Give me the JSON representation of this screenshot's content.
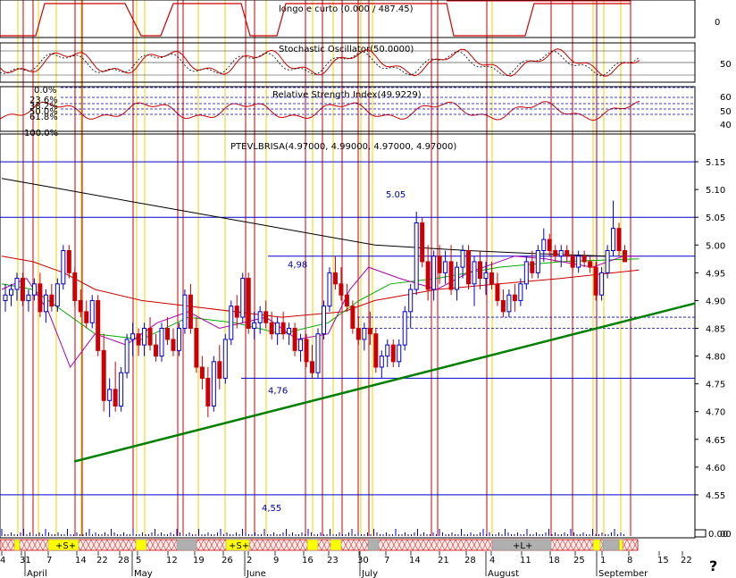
{
  "chart_data": {
    "type": "candlestick",
    "instrument_title": "PTEVLBRISA(4.97000, 4.99000, 4.97000, 4.97000)",
    "indicator_titles": {
      "top": "longo e curto (0.000 / 487.45)",
      "stochastic": "Stochastic Oscillator(50.0000)",
      "rsi": "Relative Strength Index(49.9229)"
    },
    "price_axis": {
      "ylim": [
        4.5,
        5.2
      ],
      "ticks": [
        "5.15",
        "5.10",
        "5.05",
        "5.00",
        "4.95",
        "4.90",
        "4.85",
        "4.80",
        "4.75",
        "4.70",
        "4.65",
        "4.60",
        "4.55"
      ]
    },
    "top_axis_ticks": [
      "0"
    ],
    "stochastic_axis_ticks": [
      "50"
    ],
    "rsi_axis_ticks": [
      "60",
      "50",
      "40"
    ],
    "fibonacci_levels": [
      "0.0%",
      "23.6%",
      "38.2%",
      "50.0%",
      "61.8%",
      "100.0%"
    ],
    "date_ticks": [
      "4",
      "31",
      "7",
      "14",
      "22",
      "28",
      "5",
      "12",
      "19",
      "26",
      "2",
      "9",
      "16",
      "23",
      "30",
      "7",
      "14",
      "21",
      "28",
      "4",
      "11",
      "18",
      "25",
      "1",
      "8",
      "15",
      "22"
    ],
    "month_labels": [
      "April",
      "May",
      "June",
      "July",
      "August",
      "September"
    ],
    "volume_axis_tick": "0.00",
    "horizontal_levels": [
      {
        "value": 5.15,
        "label": ""
      },
      {
        "value": 5.05,
        "label": "5.05"
      },
      {
        "value": 4.98,
        "label": "4,98"
      },
      {
        "value": 4.76,
        "label": "4,76"
      },
      {
        "value": 4.55,
        "label": "4,55"
      }
    ],
    "trendline": {
      "start": {
        "bar": 21,
        "price": 4.61
      },
      "end": {
        "bar": 200,
        "price": 4.935
      }
    },
    "candles": [
      {
        "o": 4.9,
        "h": 4.93,
        "l": 4.88,
        "c": 4.91
      },
      {
        "o": 4.91,
        "h": 4.93,
        "l": 4.89,
        "c": 4.92
      },
      {
        "o": 4.92,
        "h": 4.95,
        "l": 4.9,
        "c": 4.94
      },
      {
        "o": 4.94,
        "h": 4.95,
        "l": 4.89,
        "c": 4.9
      },
      {
        "o": 4.9,
        "h": 4.92,
        "l": 4.88,
        "c": 4.91
      },
      {
        "o": 4.91,
        "h": 4.94,
        "l": 4.9,
        "c": 4.93
      },
      {
        "o": 4.93,
        "h": 4.95,
        "l": 4.87,
        "c": 4.88
      },
      {
        "o": 4.88,
        "h": 4.92,
        "l": 4.86,
        "c": 4.91
      },
      {
        "o": 4.91,
        "h": 4.93,
        "l": 4.88,
        "c": 4.89
      },
      {
        "o": 4.89,
        "h": 4.94,
        "l": 4.88,
        "c": 4.93
      },
      {
        "o": 4.93,
        "h": 5.0,
        "l": 4.92,
        "c": 4.99
      },
      {
        "o": 4.99,
        "h": 5.0,
        "l": 4.94,
        "c": 4.95
      },
      {
        "o": 4.95,
        "h": 4.96,
        "l": 4.89,
        "c": 4.9
      },
      {
        "o": 4.9,
        "h": 4.92,
        "l": 4.87,
        "c": 4.88
      },
      {
        "o": 4.88,
        "h": 4.9,
        "l": 4.85,
        "c": 4.86
      },
      {
        "o": 4.86,
        "h": 4.91,
        "l": 4.85,
        "c": 4.9
      },
      {
        "o": 4.9,
        "h": 4.91,
        "l": 4.8,
        "c": 4.81
      },
      {
        "o": 4.81,
        "h": 4.84,
        "l": 4.7,
        "c": 4.72
      },
      {
        "o": 4.72,
        "h": 4.76,
        "l": 4.69,
        "c": 4.74
      },
      {
        "o": 4.74,
        "h": 4.79,
        "l": 4.7,
        "c": 4.71
      },
      {
        "o": 4.71,
        "h": 4.78,
        "l": 4.7,
        "c": 4.77
      },
      {
        "o": 4.77,
        "h": 4.84,
        "l": 4.76,
        "c": 4.83
      },
      {
        "o": 4.83,
        "h": 4.86,
        "l": 4.8,
        "c": 4.84
      },
      {
        "o": 4.84,
        "h": 4.85,
        "l": 4.8,
        "c": 4.82
      },
      {
        "o": 4.82,
        "h": 4.86,
        "l": 4.8,
        "c": 4.85
      },
      {
        "o": 4.85,
        "h": 4.87,
        "l": 4.81,
        "c": 4.82
      },
      {
        "o": 4.82,
        "h": 4.84,
        "l": 4.79,
        "c": 4.8
      },
      {
        "o": 4.8,
        "h": 4.86,
        "l": 4.79,
        "c": 4.85
      },
      {
        "o": 4.85,
        "h": 4.87,
        "l": 4.82,
        "c": 4.83
      },
      {
        "o": 4.83,
        "h": 4.85,
        "l": 4.8,
        "c": 4.81
      },
      {
        "o": 4.81,
        "h": 4.86,
        "l": 4.8,
        "c": 4.85
      },
      {
        "o": 4.85,
        "h": 4.92,
        "l": 4.84,
        "c": 4.91
      },
      {
        "o": 4.91,
        "h": 4.93,
        "l": 4.84,
        "c": 4.85
      },
      {
        "o": 4.85,
        "h": 4.87,
        "l": 4.77,
        "c": 4.78
      },
      {
        "o": 4.78,
        "h": 4.8,
        "l": 4.74,
        "c": 4.76
      },
      {
        "o": 4.76,
        "h": 4.78,
        "l": 4.69,
        "c": 4.71
      },
      {
        "o": 4.71,
        "h": 4.8,
        "l": 4.7,
        "c": 4.79
      },
      {
        "o": 4.79,
        "h": 4.82,
        "l": 4.74,
        "c": 4.76
      },
      {
        "o": 4.76,
        "h": 4.84,
        "l": 4.75,
        "c": 4.83
      },
      {
        "o": 4.83,
        "h": 4.9,
        "l": 4.82,
        "c": 4.89
      },
      {
        "o": 4.89,
        "h": 4.91,
        "l": 4.85,
        "c": 4.87
      },
      {
        "o": 4.87,
        "h": 4.95,
        "l": 4.86,
        "c": 4.94
      },
      {
        "o": 4.94,
        "h": 4.95,
        "l": 4.84,
        "c": 4.85
      },
      {
        "o": 4.85,
        "h": 4.88,
        "l": 4.83,
        "c": 4.86
      },
      {
        "o": 4.86,
        "h": 4.89,
        "l": 4.84,
        "c": 4.88
      },
      {
        "o": 4.88,
        "h": 4.9,
        "l": 4.85,
        "c": 4.86
      },
      {
        "o": 4.86,
        "h": 4.88,
        "l": 4.83,
        "c": 4.84
      },
      {
        "o": 4.84,
        "h": 4.87,
        "l": 4.82,
        "c": 4.86
      },
      {
        "o": 4.86,
        "h": 4.88,
        "l": 4.83,
        "c": 4.84
      },
      {
        "o": 4.84,
        "h": 4.86,
        "l": 4.82,
        "c": 4.85
      },
      {
        "o": 4.85,
        "h": 4.86,
        "l": 4.8,
        "c": 4.81
      },
      {
        "o": 4.81,
        "h": 4.84,
        "l": 4.79,
        "c": 4.83
      },
      {
        "o": 4.83,
        "h": 4.84,
        "l": 4.78,
        "c": 4.79
      },
      {
        "o": 4.79,
        "h": 4.82,
        "l": 4.76,
        "c": 4.77
      },
      {
        "o": 4.77,
        "h": 4.85,
        "l": 4.76,
        "c": 4.84
      },
      {
        "o": 4.84,
        "h": 4.9,
        "l": 4.83,
        "c": 4.89
      },
      {
        "o": 4.89,
        "h": 4.96,
        "l": 4.88,
        "c": 4.95
      },
      {
        "o": 4.95,
        "h": 4.98,
        "l": 4.92,
        "c": 4.93
      },
      {
        "o": 4.93,
        "h": 4.96,
        "l": 4.9,
        "c": 4.91
      },
      {
        "o": 4.91,
        "h": 4.93,
        "l": 4.88,
        "c": 4.89
      },
      {
        "o": 4.89,
        "h": 4.9,
        "l": 4.84,
        "c": 4.85
      },
      {
        "o": 4.85,
        "h": 4.87,
        "l": 4.82,
        "c": 4.83
      },
      {
        "o": 4.83,
        "h": 4.86,
        "l": 4.81,
        "c": 4.85
      },
      {
        "o": 4.85,
        "h": 4.88,
        "l": 4.82,
        "c": 4.84
      },
      {
        "o": 4.84,
        "h": 4.85,
        "l": 4.77,
        "c": 4.78
      },
      {
        "o": 4.78,
        "h": 4.81,
        "l": 4.76,
        "c": 4.8
      },
      {
        "o": 4.8,
        "h": 4.83,
        "l": 4.78,
        "c": 4.82
      },
      {
        "o": 4.82,
        "h": 4.83,
        "l": 4.78,
        "c": 4.79
      },
      {
        "o": 4.79,
        "h": 4.83,
        "l": 4.78,
        "c": 4.82
      },
      {
        "o": 4.82,
        "h": 4.89,
        "l": 4.81,
        "c": 4.88
      },
      {
        "o": 4.88,
        "h": 4.93,
        "l": 4.85,
        "c": 4.92
      },
      {
        "o": 4.92,
        "h": 5.06,
        "l": 4.91,
        "c": 5.04
      },
      {
        "o": 5.04,
        "h": 5.05,
        "l": 4.96,
        "c": 4.97
      },
      {
        "o": 4.97,
        "h": 5.0,
        "l": 4.9,
        "c": 4.92
      },
      {
        "o": 4.92,
        "h": 4.99,
        "l": 4.9,
        "c": 4.98
      },
      {
        "o": 4.98,
        "h": 5.0,
        "l": 4.93,
        "c": 4.95
      },
      {
        "o": 4.95,
        "h": 4.99,
        "l": 4.93,
        "c": 4.97
      },
      {
        "o": 4.97,
        "h": 5.0,
        "l": 4.91,
        "c": 4.92
      },
      {
        "o": 4.92,
        "h": 4.97,
        "l": 4.9,
        "c": 4.96
      },
      {
        "o": 4.96,
        "h": 5.0,
        "l": 4.94,
        "c": 4.99
      },
      {
        "o": 4.99,
        "h": 5.0,
        "l": 4.92,
        "c": 4.93
      },
      {
        "o": 4.93,
        "h": 4.98,
        "l": 4.89,
        "c": 4.97
      },
      {
        "o": 4.97,
        "h": 4.99,
        "l": 4.92,
        "c": 4.94
      },
      {
        "o": 4.94,
        "h": 4.97,
        "l": 4.91,
        "c": 4.95
      },
      {
        "o": 4.95,
        "h": 4.97,
        "l": 4.92,
        "c": 4.93
      },
      {
        "o": 4.93,
        "h": 4.95,
        "l": 4.89,
        "c": 4.9
      },
      {
        "o": 4.9,
        "h": 4.92,
        "l": 4.87,
        "c": 4.88
      },
      {
        "o": 4.88,
        "h": 4.92,
        "l": 4.87,
        "c": 4.91
      },
      {
        "o": 4.91,
        "h": 4.93,
        "l": 4.88,
        "c": 4.9
      },
      {
        "o": 4.9,
        "h": 4.94,
        "l": 4.89,
        "c": 4.93
      },
      {
        "o": 4.93,
        "h": 4.98,
        "l": 4.92,
        "c": 4.97
      },
      {
        "o": 4.97,
        "h": 4.99,
        "l": 4.94,
        "c": 4.95
      },
      {
        "o": 4.95,
        "h": 5.0,
        "l": 4.94,
        "c": 4.99
      },
      {
        "o": 4.99,
        "h": 5.03,
        "l": 4.97,
        "c": 5.01
      },
      {
        "o": 5.01,
        "h": 5.02,
        "l": 4.98,
        "c": 4.99
      },
      {
        "o": 4.99,
        "h": 5.0,
        "l": 4.97,
        "c": 4.98
      },
      {
        "o": 4.98,
        "h": 5.0,
        "l": 4.96,
        "c": 4.99
      },
      {
        "o": 4.99,
        "h": 5.0,
        "l": 4.97,
        "c": 4.98
      },
      {
        "o": 4.98,
        "h": 4.99,
        "l": 4.95,
        "c": 4.96
      },
      {
        "o": 4.96,
        "h": 4.99,
        "l": 4.95,
        "c": 4.98
      },
      {
        "o": 4.98,
        "h": 4.99,
        "l": 4.96,
        "c": 4.97
      },
      {
        "o": 4.97,
        "h": 4.98,
        "l": 4.95,
        "c": 4.96
      },
      {
        "o": 4.96,
        "h": 4.97,
        "l": 4.9,
        "c": 4.91
      },
      {
        "o": 4.91,
        "h": 4.96,
        "l": 4.9,
        "c": 4.95
      },
      {
        "o": 4.95,
        "h": 5.0,
        "l": 4.94,
        "c": 4.99
      },
      {
        "o": 4.99,
        "h": 5.08,
        "l": 4.98,
        "c": 5.03
      },
      {
        "o": 5.03,
        "h": 5.04,
        "l": 4.98,
        "c": 4.99
      },
      {
        "o": 4.99,
        "h": 5.0,
        "l": 4.97,
        "c": 4.97
      }
    ],
    "moving_averages": [
      {
        "name": "",
        "color": "#000000",
        "values_desc": "long MA"
      },
      {
        "name": "",
        "color": "#cc0000",
        "values_desc": "medium MA"
      },
      {
        "name": "",
        "color": "#00aa00",
        "values_desc": "short MA"
      },
      {
        "name": "",
        "color": "#aa00aa",
        "values_desc": "fast MA"
      }
    ],
    "bottom_bar_labels": [
      "+S+",
      "+S+",
      "+L+"
    ],
    "scrollbar_label": "00",
    "help_label": "?"
  }
}
